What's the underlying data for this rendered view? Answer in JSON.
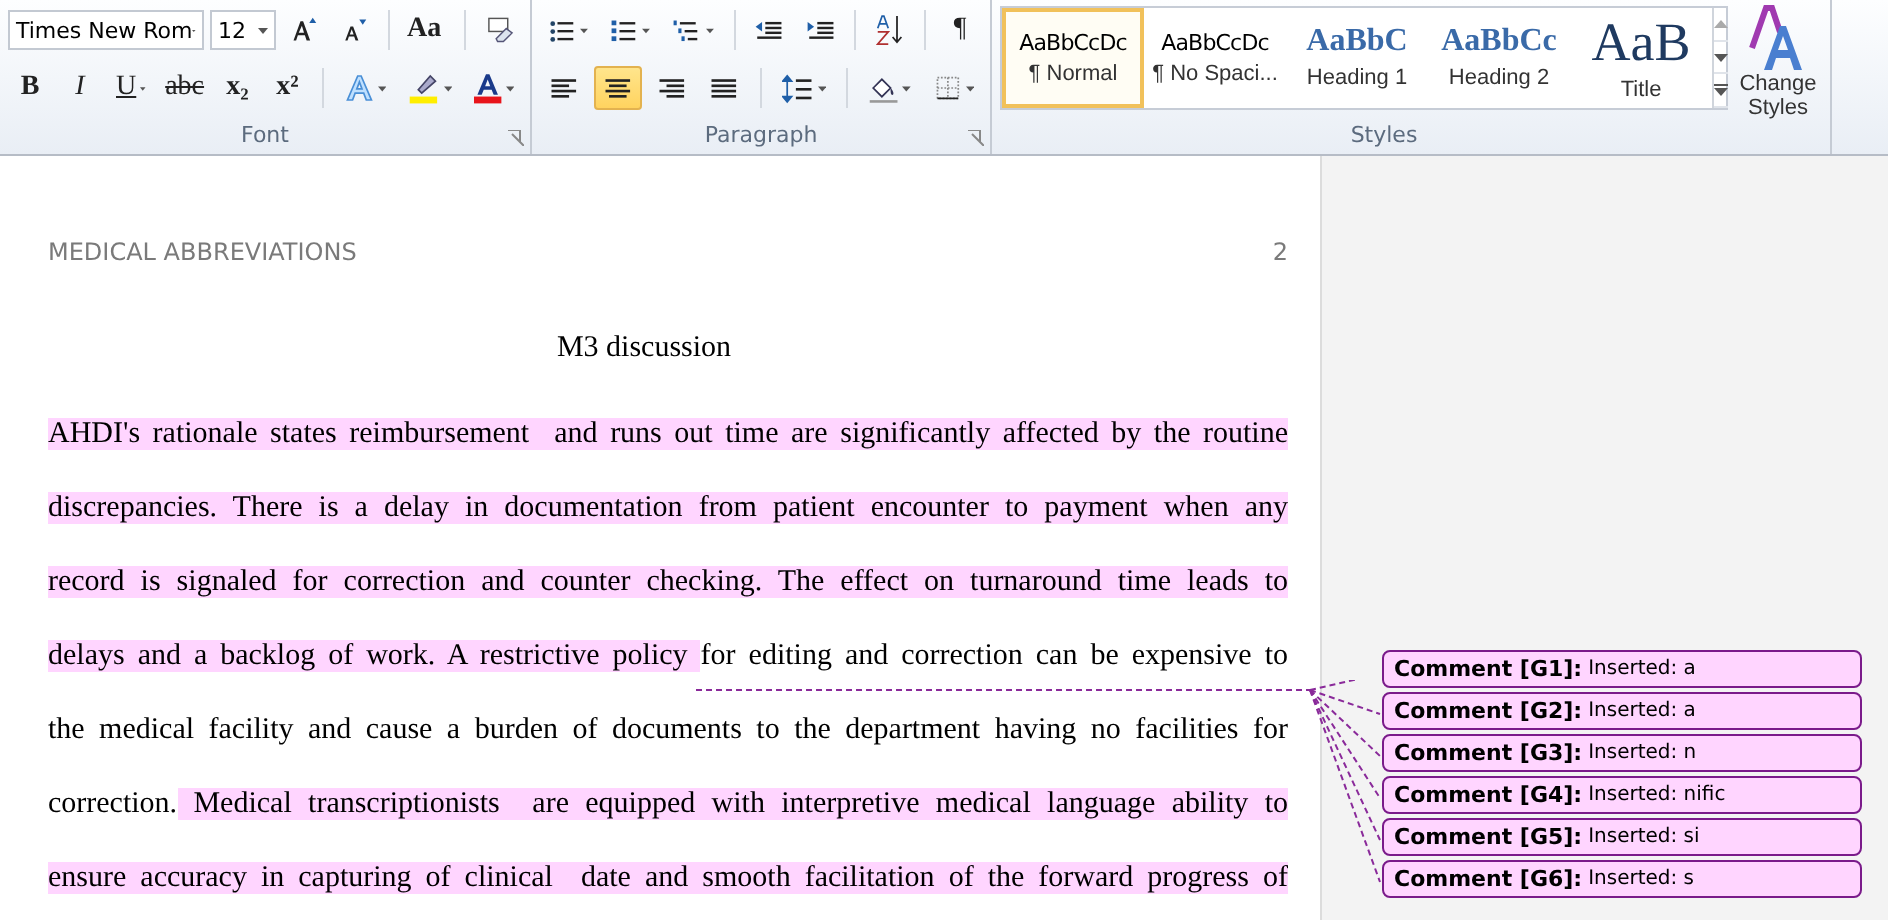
{
  "ribbon": {
    "font": {
      "label": "Font",
      "font_name": "Times New Rom",
      "font_size": "12",
      "change_case": "Aa",
      "bold": "B",
      "italic": "I",
      "underline": "U",
      "strikethrough": "abc",
      "subscript": "x₂",
      "superscript": "x²"
    },
    "paragraph": {
      "label": "Paragraph",
      "show_marks": "¶",
      "alignment": [
        {
          "kind": "left",
          "selected": false
        },
        {
          "kind": "center",
          "selected": true
        },
        {
          "kind": "right",
          "selected": false
        },
        {
          "kind": "justify",
          "selected": false
        }
      ]
    },
    "styles": {
      "label": "Styles",
      "items": [
        {
          "kind": "normal",
          "preview": "AaBbCcDc",
          "label": "¶ Normal",
          "selected": true
        },
        {
          "kind": "normal",
          "preview": "AaBbCcDc",
          "label": "¶ No Spaci...",
          "selected": false
        },
        {
          "kind": "heading1",
          "preview": "AaBbC",
          "label": "Heading 1",
          "selected": false
        },
        {
          "kind": "heading2",
          "preview": "AaBbCc",
          "label": "Heading 2",
          "selected": false
        },
        {
          "kind": "title",
          "preview": "AaB",
          "label": "Title",
          "selected": false
        }
      ],
      "change_styles": "Change Styles"
    }
  },
  "document": {
    "header": "MEDICAL ABBREVIATIONS",
    "page_number": "2",
    "title": "M3 discussion",
    "lines": [
      [
        {
          "text": "AHDI's rationale states reimbursement  and runs out time are significantly affected by the routine",
          "inserted": true
        }
      ],
      [
        {
          "text": "discrepancies. There is a delay in documentation from patient encounter to payment when any",
          "inserted": true
        }
      ],
      [
        {
          "text": "record is signaled for correction and counter checking. The effect on turnaround time leads to",
          "inserted": true
        }
      ],
      [
        {
          "text": "delays and a backlog of work. A restrictive policy ",
          "inserted": true
        },
        {
          "text": "for editing and correction can be expensive to",
          "inserted": false
        }
      ],
      [
        {
          "text": "the medical facility and cause a burden of documents to the department having no facilities for",
          "inserted": false
        }
      ],
      [
        {
          "text": "correction.",
          "inserted": false
        },
        {
          "text": " Medical transcriptionists  are equipped with interpretive medical language ability to",
          "inserted": true
        }
      ],
      [
        {
          "text": "ensure accuracy in capturing of clinical  date and smooth facilitation of the forward progress of",
          "inserted": true
        }
      ]
    ]
  },
  "comments": [
    {
      "label": "Comment [G1]:",
      "text": "Inserted: a"
    },
    {
      "label": "Comment [G2]:",
      "text": "Inserted: a"
    },
    {
      "label": "Comment [G3]:",
      "text": "Inserted: n"
    },
    {
      "label": "Comment [G4]:",
      "text": "Inserted: nific"
    },
    {
      "label": "Comment [G5]:",
      "text": "Inserted: si"
    },
    {
      "label": "Comment [G6]:",
      "text": "Inserted: s"
    }
  ]
}
